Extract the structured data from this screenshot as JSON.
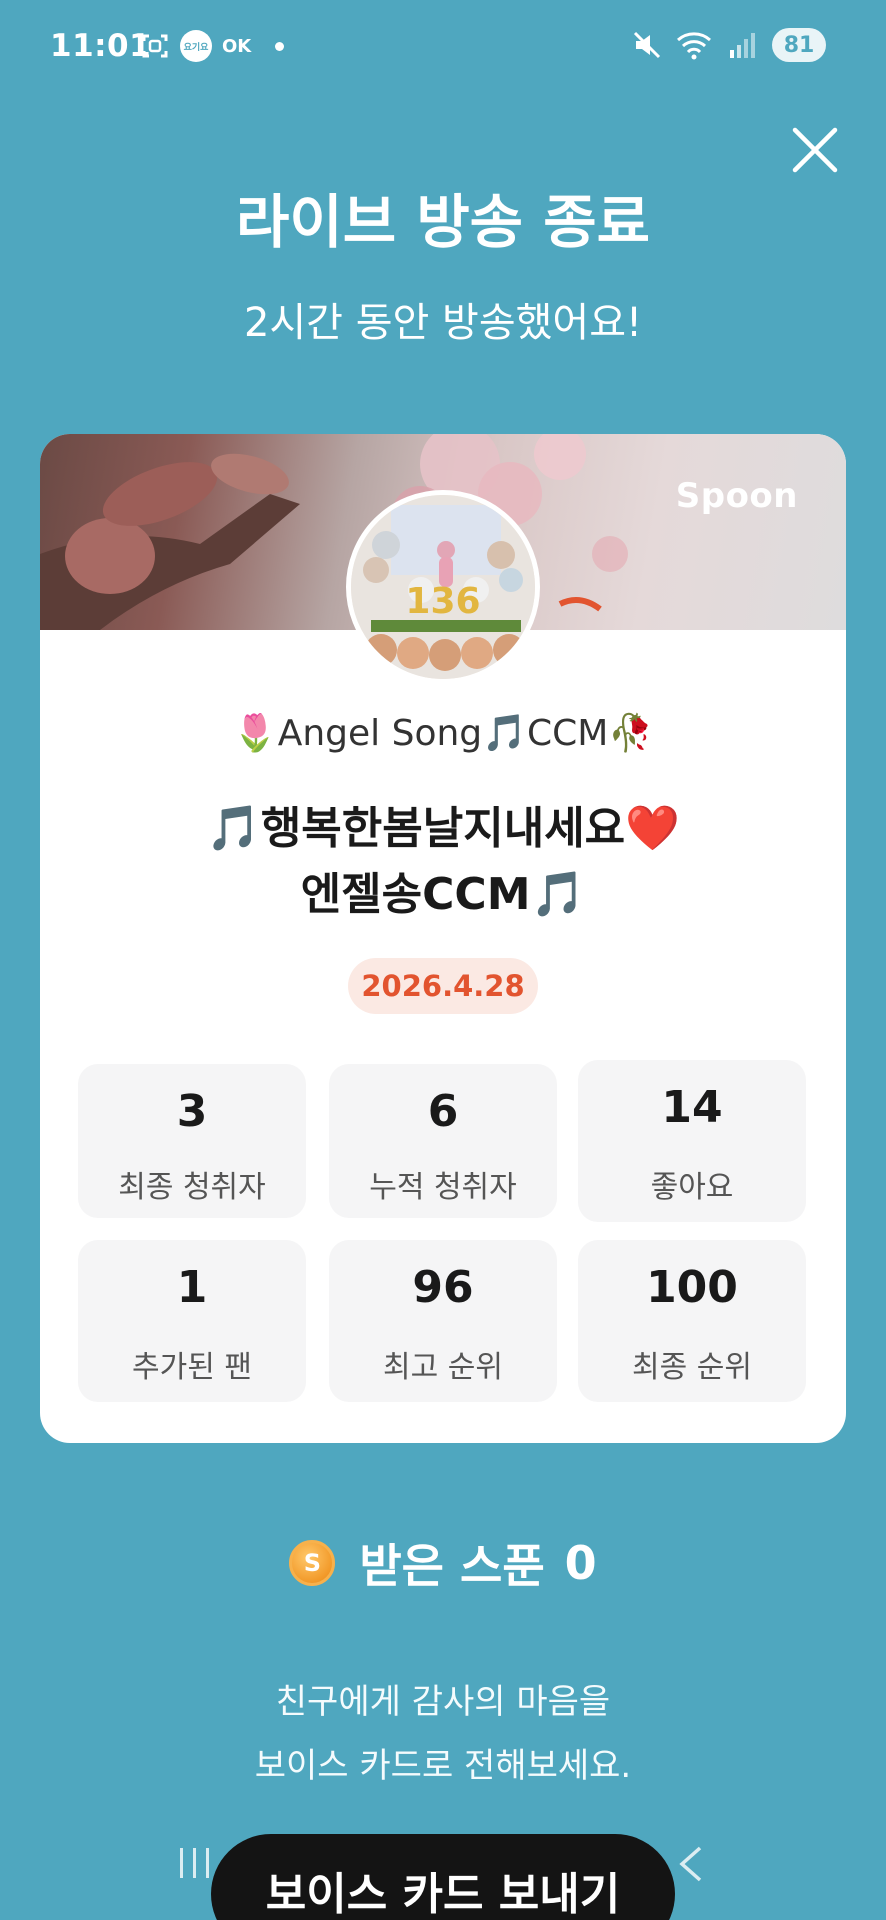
{
  "status_bar": {
    "time": "11:01",
    "badge_text": "요기요",
    "ok_text": "OK",
    "battery": "81"
  },
  "header": {
    "title": "라이브 방송 종료",
    "subtitle": "2시간 동안 방송했어요!"
  },
  "card": {
    "brand": "Spoon",
    "dj_name": "🌷Angel Song🎵CCM🥀",
    "broadcast_title_line1": "🎵행복한봄날지내세요❤️",
    "broadcast_title_line2": "엔젤송CCM🎵",
    "date": "2026.4.28",
    "stats": [
      {
        "value": "3",
        "label": "최종 청취자"
      },
      {
        "value": "6",
        "label": "누적 청취자"
      },
      {
        "value": "14",
        "label": "좋아요"
      },
      {
        "value": "1",
        "label": "추가된 팬"
      },
      {
        "value": "96",
        "label": "최고 순위"
      },
      {
        "value": "100",
        "label": "최종 순위"
      }
    ]
  },
  "spoons": {
    "coin_letter": "S",
    "label": "받은 스푼",
    "count": "0"
  },
  "message": {
    "line1": "친구에게 감사의 마음을",
    "line2": "보이스 카드로 전해보세요."
  },
  "cta": {
    "label": "보이스 카드 보내기"
  },
  "colors": {
    "background": "#4fa7bf",
    "date_accent": "#e2542f",
    "coin": "#f29a2a"
  },
  "icons": [
    "screenshot-icon",
    "close-icon",
    "mute-icon",
    "wifi-icon",
    "signal-icon",
    "spoon-coin-icon",
    "nav-recent-icon",
    "nav-home-icon",
    "nav-back-icon"
  ]
}
